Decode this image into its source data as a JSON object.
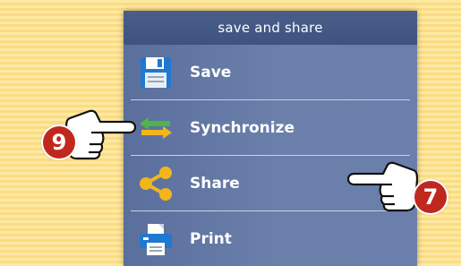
{
  "panel": {
    "title": "save and share",
    "items": [
      {
        "label": "Save",
        "icon": "floppy-disk-icon"
      },
      {
        "label": "Synchronize",
        "icon": "sync-arrows-icon"
      },
      {
        "label": "Share",
        "icon": "share-nodes-icon"
      },
      {
        "label": "Print",
        "icon": "printer-icon"
      }
    ]
  },
  "callouts": {
    "left_number": "9",
    "right_number": "7"
  },
  "colors": {
    "panel": "#6a7fab",
    "header": "#44588a",
    "badge": "#c0281f",
    "background": "#fbdc82"
  }
}
